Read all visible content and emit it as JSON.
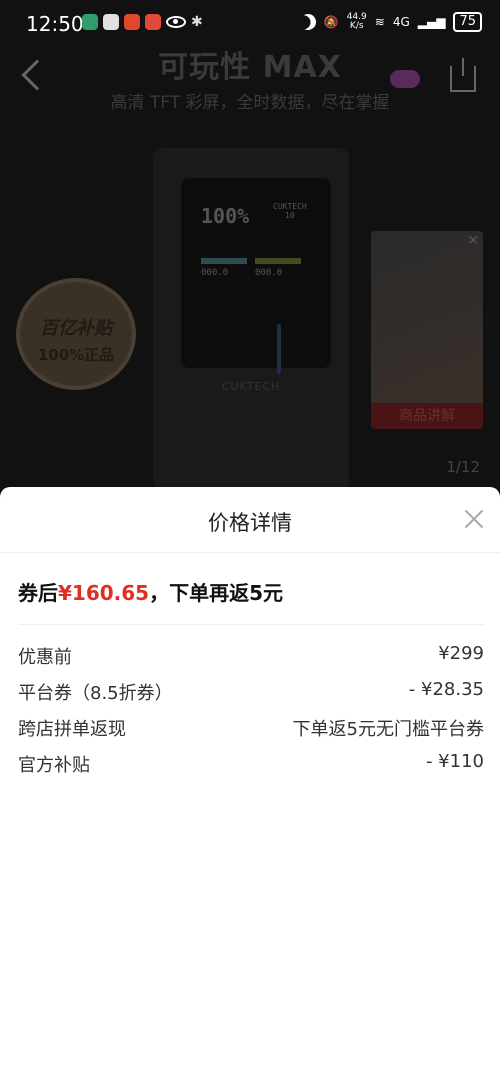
{
  "status_bar": {
    "time": "12:50",
    "net_speed_value": "44.9",
    "net_speed_unit": "K/s",
    "network": "4G",
    "battery": "75",
    "app_icon_colors": [
      "#2e9e6a",
      "#e0e0e0",
      "#e04a2a",
      "#e04a3a"
    ]
  },
  "hero": {
    "title": "可玩性 MAX",
    "subtitle": "高清 TFT 彩屏，全时数据，尽在掌握"
  },
  "product": {
    "screen_percent": "100%",
    "screen_brand": "CUKTECH",
    "screen_model": "10",
    "screen_value_left": "000.0",
    "screen_value_right": "000.0",
    "brand": "CUKTECH"
  },
  "badge": {
    "line1": "百亿补贴",
    "line2": "100%正品"
  },
  "video": {
    "label": "商品讲解"
  },
  "gallery": {
    "indicator": "1/12"
  },
  "sheet": {
    "title": "价格详情",
    "summary_prefix": "券后",
    "summary_price": "¥160.65",
    "summary_suffix": "，下单再返5元",
    "rows": [
      {
        "label": "优惠前",
        "value": "¥299"
      },
      {
        "label": "平台券（8.5折券）",
        "value": "- ¥28.35"
      },
      {
        "label": "跨店拼单返现",
        "value": "下单返5元无门槛平台券"
      },
      {
        "label": "官方补贴",
        "value": "- ¥110"
      }
    ]
  },
  "colors": {
    "accent_red": "#e02e24",
    "overlay_bg": "#111111"
  }
}
